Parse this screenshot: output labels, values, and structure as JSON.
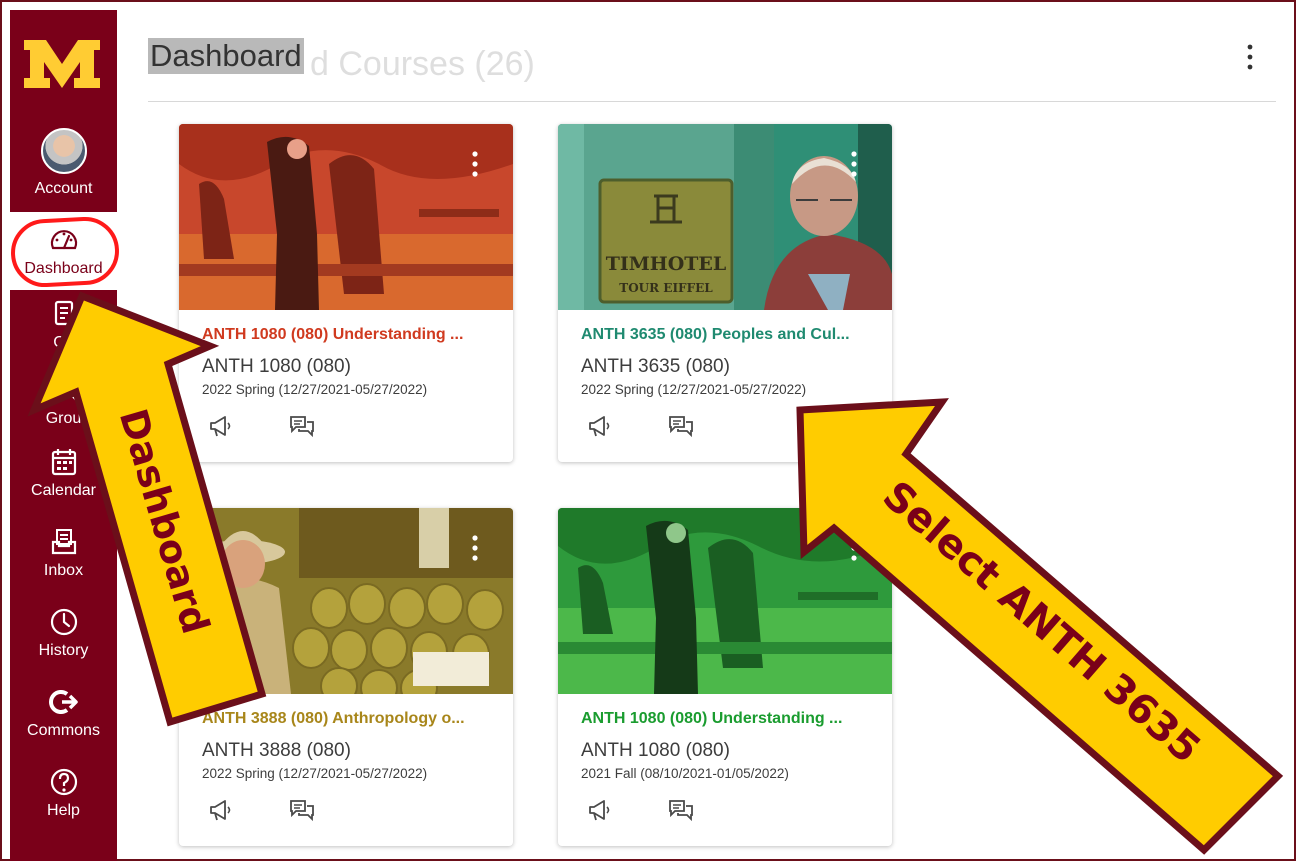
{
  "nav": {
    "items": [
      {
        "id": "account",
        "label": "Account"
      },
      {
        "id": "dashboard",
        "label": "Dashboard"
      },
      {
        "id": "courses",
        "label": "Co"
      },
      {
        "id": "groups",
        "label": "Grou"
      },
      {
        "id": "calendar",
        "label": "Calendar"
      },
      {
        "id": "inbox",
        "label": "Inbox"
      },
      {
        "id": "history",
        "label": "History"
      },
      {
        "id": "commons",
        "label": "Commons"
      },
      {
        "id": "help",
        "label": "Help"
      }
    ]
  },
  "header": {
    "title": "Dashboard",
    "ghost_title": "d Courses (26)"
  },
  "cards": [
    {
      "title": "ANTH 1080 (080) Understanding ...",
      "code": "ANTH 1080 (080)",
      "term": "2022 Spring (12/27/2021-05/27/2022)",
      "color": "#d03a1f"
    },
    {
      "title": "ANTH 3635 (080) Peoples and Cul...",
      "code": "ANTH 3635 (080)",
      "term": "2022 Spring (12/27/2021-05/27/2022)",
      "color": "#1f8a70",
      "sign_line1": "TIMHOTEL",
      "sign_line2": "TOUR EIFFEL"
    },
    {
      "title": "ANTH 3888 (080) Anthropology o...",
      "code": "ANTH 3888 (080)",
      "term": "2022 Spring (12/27/2021-05/27/2022)",
      "color": "#b6921c"
    },
    {
      "title": "ANTH 1080 (080) Understanding ...",
      "code": "ANTH 1080 (080)",
      "term": "2021 Fall (08/10/2021-01/05/2022)",
      "color": "#1a9c2f"
    }
  ],
  "annotations": {
    "left_arrow": "Dashboard",
    "right_arrow": "Select ANTH 3635"
  },
  "colors": {
    "brand_maroon": "#7a0019",
    "brand_gold": "#ffcc33",
    "highlight_red": "#ff1a1a"
  },
  "icons": [
    "umn-logo",
    "account-avatar",
    "dashboard-icon",
    "courses-icon",
    "groups-icon",
    "calendar-icon",
    "inbox-icon",
    "history-icon",
    "commons-icon",
    "help-icon",
    "kebab-menu-icon",
    "announcements-icon",
    "discussions-icon"
  ]
}
